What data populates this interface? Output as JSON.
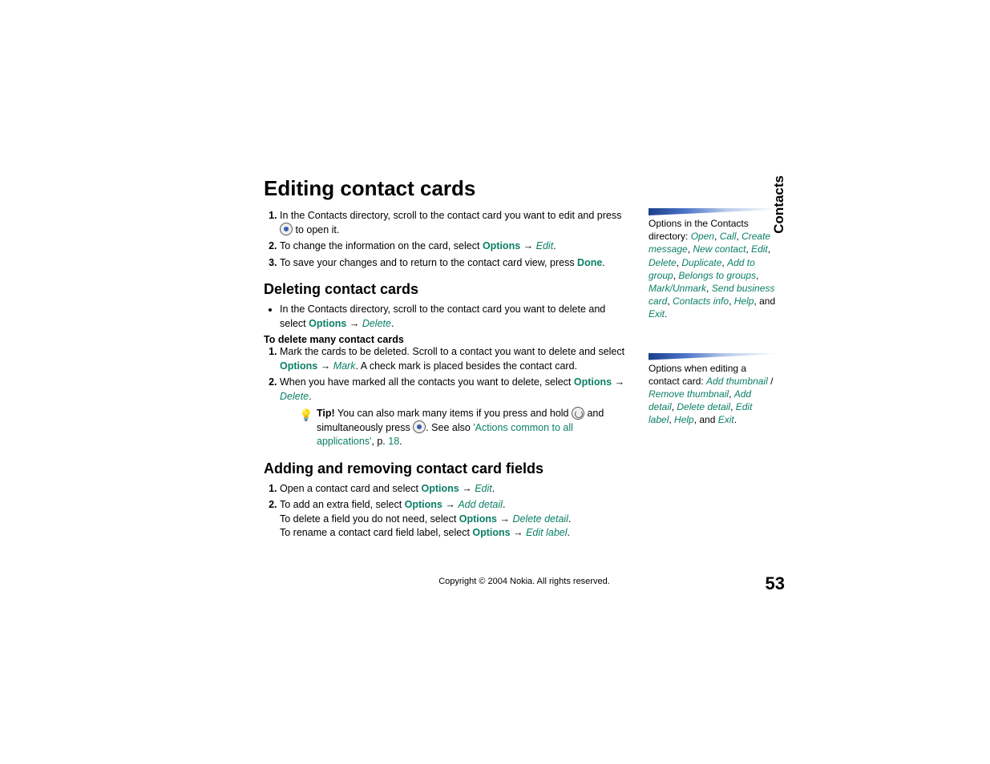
{
  "side_tab": "Contacts",
  "h1": "Editing contact cards",
  "edit_steps": [
    {
      "pre": "In the Contacts directory, scroll to the contact card you want to edit and press ",
      "post": " to open it."
    },
    {
      "pre": "To change the information on the card, select ",
      "opt": "Options",
      "act": "Edit",
      "post": "."
    },
    {
      "pre": "To save your changes and to return to the contact card view, press ",
      "done": "Done",
      "post": "."
    }
  ],
  "h2_delete": "Deleting contact cards",
  "del_bullet": {
    "pre": "In the Contacts directory, scroll to the contact card you want to delete and select ",
    "opt": "Options",
    "act": "Delete",
    "post": "."
  },
  "del_many_head": "To delete many contact cards",
  "del_steps": [
    {
      "pre": "Mark the cards to be deleted. Scroll to a contact you want to delete and select ",
      "opt": "Options",
      "act": "Mark",
      "post2": ". A check mark is placed besides the contact card."
    },
    {
      "pre": "When you have marked all the contacts you want to delete, select ",
      "opt": "Options",
      "act": "Delete",
      "post": "."
    }
  ],
  "tip": {
    "label": "Tip!",
    "t1": " You can also mark many items if you press and hold ",
    "t2": " and simultaneously press ",
    "t3": ". See also ",
    "link": "'Actions common to all applications'",
    "t4": ", p. ",
    "pg": "18",
    "post": "."
  },
  "h2_add": "Adding and removing contact card fields",
  "add_steps": [
    {
      "pre": "Open a contact card and select ",
      "opt": "Options",
      "act": "Edit",
      "post": "."
    },
    {
      "pre": "To add an extra field, select ",
      "opt": "Options",
      "act": "Add detail",
      "post": ".",
      "l2_pre": "To delete a field you do not need, select ",
      "l2_opt": "Options",
      "l2_act": "Delete detail",
      "l2_post": ".",
      "l3_pre": "To rename a contact card field label, select ",
      "l3_opt": "Options",
      "l3_act": "Edit label",
      "l3_post": "."
    }
  ],
  "side1": {
    "intro": "Options in the Contacts directory: ",
    "items": [
      "Open",
      "Call",
      "Create message",
      "New contact",
      "Edit",
      "Delete",
      "Duplicate",
      "Add to group",
      "Belongs to groups",
      "Mark/Unmark",
      "Send business card",
      "Contacts info",
      "Help"
    ],
    "and": ", and ",
    "last": "Exit",
    "post": "."
  },
  "side2": {
    "intro": "Options when editing a contact card: ",
    "i1": "Add thumbnail",
    "sep": " / ",
    "i2": "Remove thumbnail",
    "items": [
      "Add detail",
      "Delete detail",
      "Edit label",
      "Help"
    ],
    "and": ", and ",
    "last": "Exit",
    "post": "."
  },
  "footer": {
    "copy": "Copyright © 2004 Nokia. All rights reserved.",
    "page": "53"
  }
}
